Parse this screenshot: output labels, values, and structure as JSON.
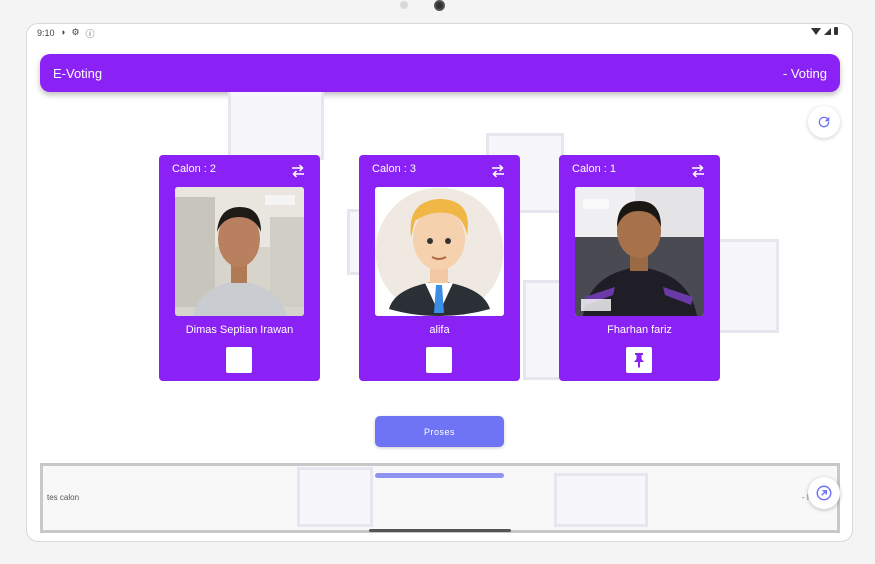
{
  "status": {
    "time": "9:10",
    "icons": [
      "alarm-icon",
      "settings-icon",
      "info-icon",
      "wifi-icon",
      "signal-icon",
      "battery-icon"
    ]
  },
  "appbar": {
    "title": "E-Voting",
    "subtitle": "- Voting",
    "color": "#8a21f5"
  },
  "candidates": [
    {
      "label": "Calon : 2",
      "name": "Dimas Septian Irawan",
      "checked": false,
      "photo": "man-photo"
    },
    {
      "label": "Calon : 3",
      "name": "alifa",
      "checked": false,
      "photo": "cartoon-avatar"
    },
    {
      "label": "Calon : 1",
      "name": "Fharhan fariz",
      "checked": true,
      "photo": "man-photo"
    }
  ],
  "actions": {
    "proses_label": "Proses"
  },
  "bottom_panel": {
    "text": "tes calon",
    "right_text": "- I"
  },
  "colors": {
    "card": "#8a21f5",
    "button": "#6f74f5",
    "icon_accent": "#6f74f5"
  }
}
